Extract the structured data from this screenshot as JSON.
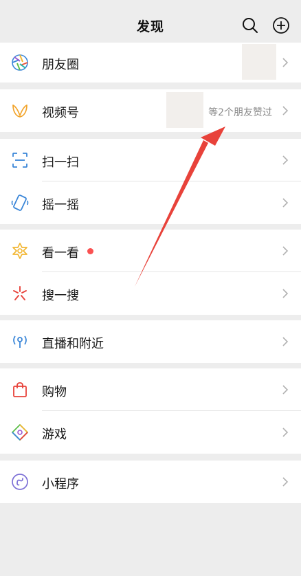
{
  "header": {
    "title": "发现",
    "search_icon": "search-icon",
    "add_icon": "plus-circle-icon"
  },
  "items": {
    "moments": {
      "label": "朋友圈",
      "icon": "moments-aperture-icon"
    },
    "channels": {
      "label": "视频号",
      "icon": "channels-butterfly-icon",
      "hint": "等2个朋友赞过"
    },
    "scan": {
      "label": "扫一扫",
      "icon": "scan-icon"
    },
    "shake": {
      "label": "摇一摇",
      "icon": "shake-icon"
    },
    "top_stories": {
      "label": "看一看",
      "icon": "top-stories-icon",
      "badge": "red-dot"
    },
    "search": {
      "label": "搜一搜",
      "icon": "search-sparkle-icon"
    },
    "live_nearby": {
      "label": "直播和附近",
      "icon": "live-nearby-icon"
    },
    "shopping": {
      "label": "购物",
      "icon": "shopping-bag-icon"
    },
    "games": {
      "label": "游戏",
      "icon": "games-icon"
    },
    "mini_programs": {
      "label": "小程序",
      "icon": "mini-programs-icon"
    }
  },
  "colors": {
    "background": "#ededed",
    "row": "#ffffff",
    "hint": "#8a8a8a",
    "badge": "#fa5151",
    "annotation_arrow": "#e8423a"
  },
  "annotation": {
    "type": "red-arrow",
    "points_to": "channels.hint"
  }
}
